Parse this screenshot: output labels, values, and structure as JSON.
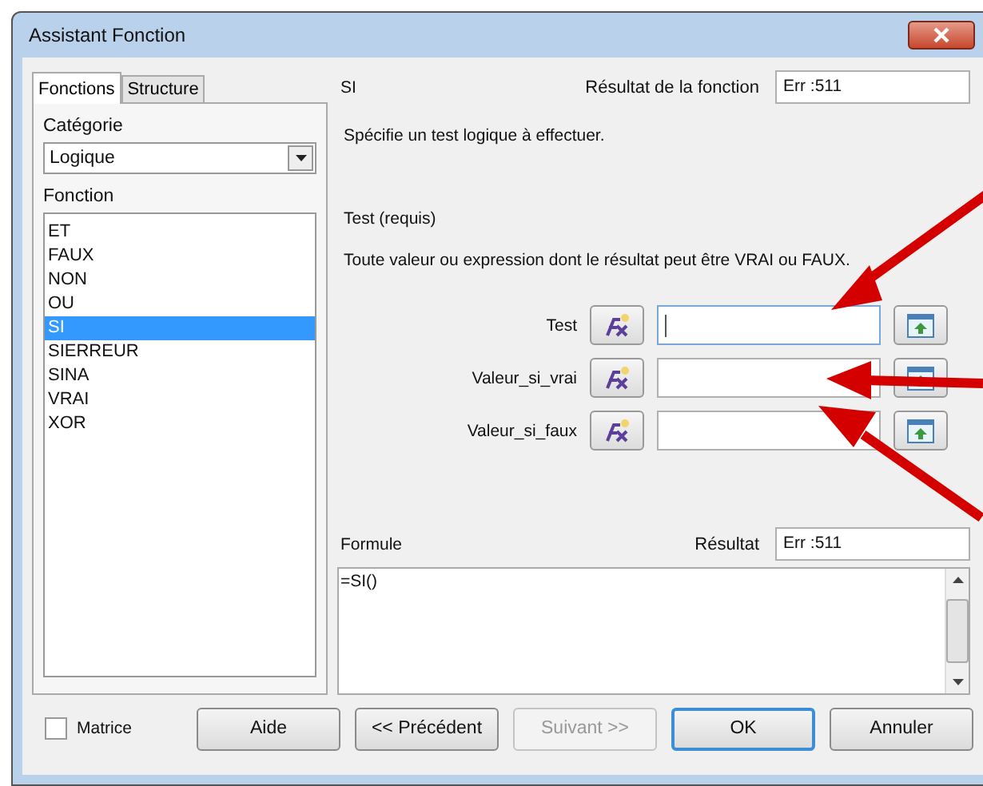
{
  "window": {
    "title": "Assistant Fonction"
  },
  "tabs": [
    {
      "label": "Fonctions",
      "selected": true
    },
    {
      "label": "Structure",
      "selected": false
    }
  ],
  "category": {
    "label": "Catégorie",
    "value": "Logique"
  },
  "functions": {
    "label": "Fonction",
    "items": [
      {
        "label": "ET",
        "selected": false
      },
      {
        "label": "FAUX",
        "selected": false
      },
      {
        "label": "NON",
        "selected": false
      },
      {
        "label": "OU",
        "selected": false
      },
      {
        "label": "SI",
        "selected": true
      },
      {
        "label": "SIERREUR",
        "selected": false
      },
      {
        "label": "SINA",
        "selected": false
      },
      {
        "label": "VRAI",
        "selected": false
      },
      {
        "label": "XOR",
        "selected": false
      }
    ]
  },
  "function_name": "SI",
  "function_result": {
    "label": "Résultat de la fonction",
    "value": "Err :511"
  },
  "description": "Spécifie un test logique à effectuer.",
  "argument_title": "Test (requis)",
  "argument_help": "Toute valeur ou expression dont le résultat peut être VRAI ou FAUX.",
  "arguments": [
    {
      "label": "Test",
      "focused": true
    },
    {
      "label": "Valeur_si_vrai",
      "focused": false
    },
    {
      "label": "Valeur_si_faux",
      "focused": false
    }
  ],
  "formula": {
    "label": "Formule",
    "value": "=SI()"
  },
  "result": {
    "label": "Résultat",
    "value": "Err :511"
  },
  "array_option": {
    "label": "Matrice",
    "checked": false
  },
  "buttons": [
    {
      "label": "Aide",
      "disabled": false,
      "default": false
    },
    {
      "label": "<< Précédent",
      "disabled": false,
      "default": false
    },
    {
      "label": "Suivant >>",
      "disabled": true,
      "default": false
    },
    {
      "label": "OK",
      "disabled": false,
      "default": true
    },
    {
      "label": "Annuler",
      "disabled": false,
      "default": false
    }
  ]
}
